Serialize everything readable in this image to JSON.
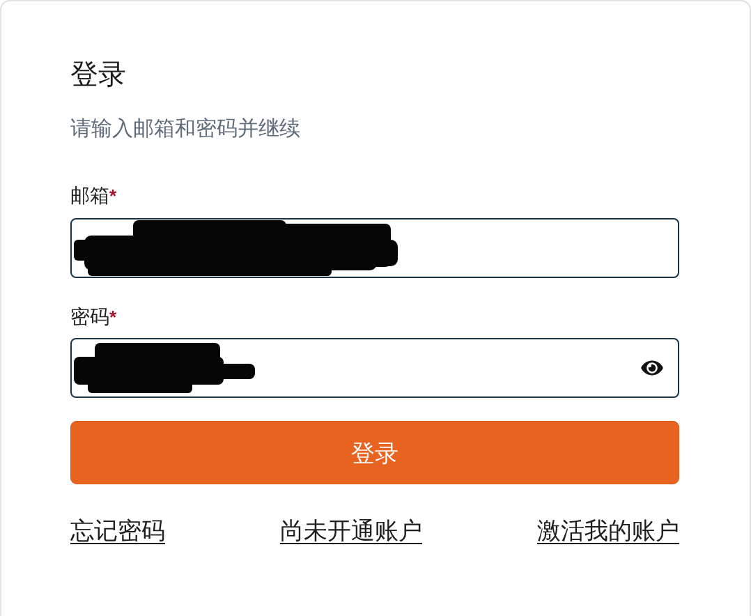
{
  "title": "登录",
  "subtitle": "请输入邮箱和密码并继续",
  "fields": [
    {
      "kind": "email",
      "label": "邮箱",
      "required_mark": "*",
      "redacted": true
    },
    {
      "kind": "password",
      "label": "密码",
      "required_mark": "*",
      "redacted": true,
      "reveal_toggle": true
    }
  ],
  "submit_button": "登录",
  "links": [
    "忘记密码",
    "尚未开通账户",
    "激活我的账户"
  ]
}
